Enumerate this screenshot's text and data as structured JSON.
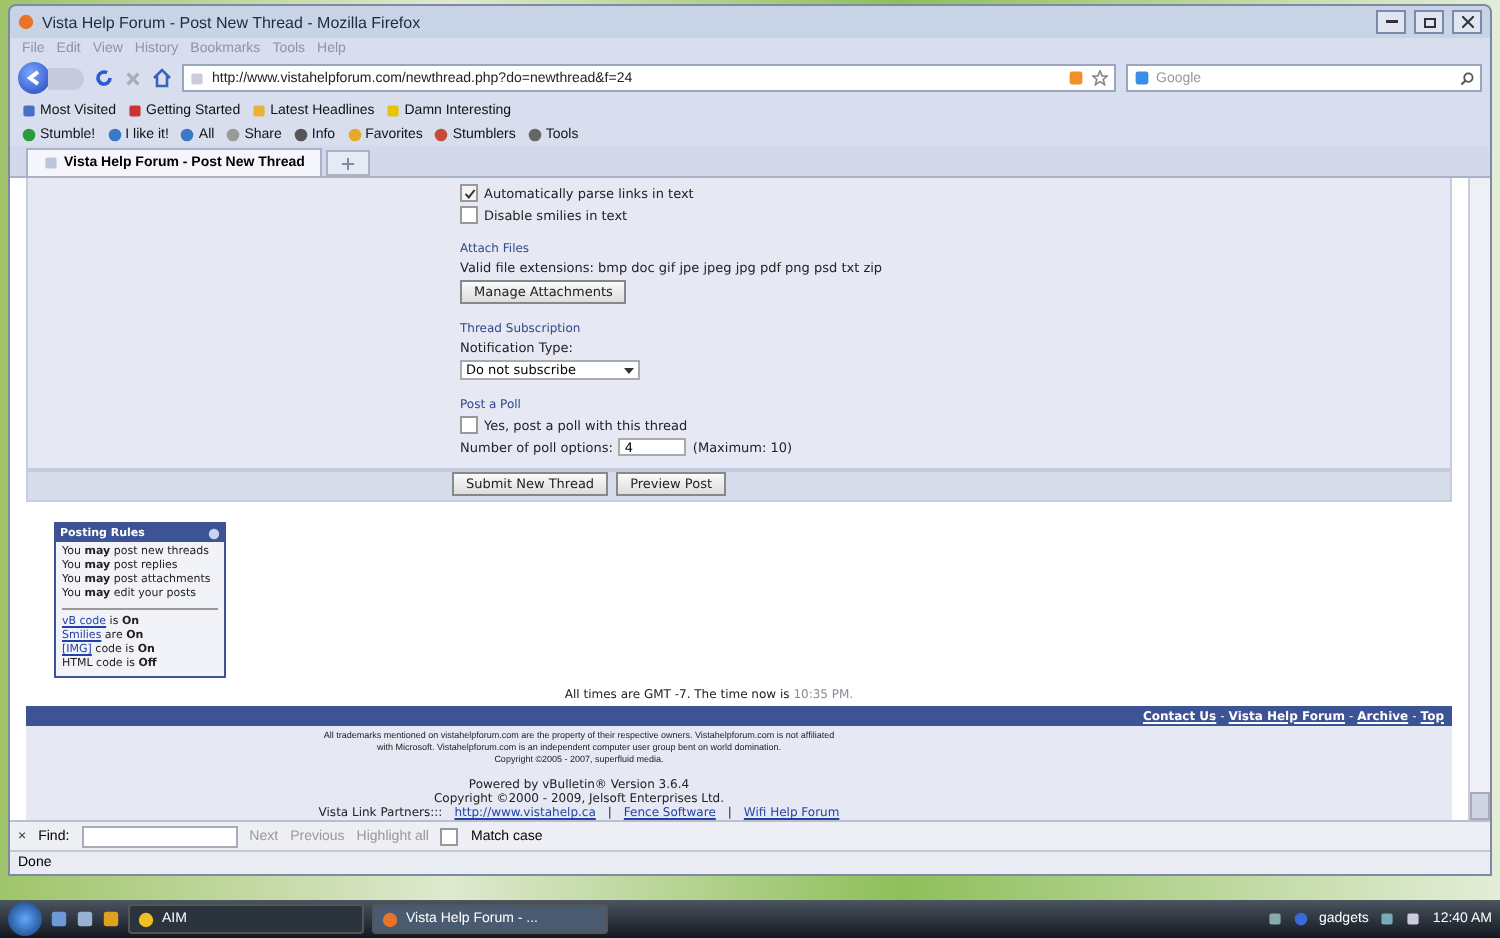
{
  "window": {
    "title": "Vista Help Forum - Post New Thread - Mozilla Firefox"
  },
  "menu": [
    "File",
    "Edit",
    "View",
    "History",
    "Bookmarks",
    "Tools",
    "Help"
  ],
  "address": {
    "url": "http://www.vistahelpforum.com/newthread.php?do=newthread&f=24"
  },
  "search": {
    "placeholder": "Google"
  },
  "bookmarks": [
    "Most Visited",
    "Getting Started",
    "Latest Headlines",
    "Damn Interesting"
  ],
  "stumble_toolbar": [
    "Stumble!",
    "I like it!",
    "All",
    "Share",
    "Info",
    "Favorites",
    "Stumblers",
    "Tools"
  ],
  "tabs": [
    {
      "label": "Vista Help Forum - Post New Thread",
      "selected": true
    }
  ],
  "options": [
    {
      "label": "Automatically parse links in text",
      "checked": true
    },
    {
      "label": "Disable smilies in text",
      "checked": false
    }
  ],
  "attach": {
    "heading": "Attach Files",
    "extensions": "Valid file extensions: bmp doc gif jpe jpeg jpg pdf png psd txt zip",
    "button": "Manage Attachments"
  },
  "subscription": {
    "heading": "Thread Subscription",
    "label": "Notification Type:",
    "value": "Do not subscribe"
  },
  "poll": {
    "heading": "Post a Poll",
    "checkbox": {
      "label": "Yes, post a poll with this thread",
      "checked": false
    },
    "options_label": "Number of poll options:",
    "options_value": "4",
    "max": "(Maximum: 10)"
  },
  "buttons": [
    "Submit New Thread",
    "Preview Post"
  ],
  "posting_rules": {
    "title": "Posting Rules",
    "permissions": [
      "You **may** post new threads",
      "You **may** post replies",
      "You **may** post attachments",
      "You **may** edit your posts"
    ],
    "codes": [
      {
        "link": "vB code",
        "text": " is **On**"
      },
      {
        "link": "Smilies",
        "text": " are **On**"
      },
      {
        "link": "[IMG]",
        "text": " code is **On**"
      },
      {
        "text": "HTML code is **Off**"
      }
    ]
  },
  "time_line": {
    "text": "All times are GMT -7. The time now is",
    "time": "10:35 PM."
  },
  "footer_links": [
    "Contact Us",
    "Vista Help Forum",
    "Archive",
    "Top"
  ],
  "footer_separator": "-",
  "disclaimer": [
    "All trademarks mentioned on vistahelpforum.com are the property of their respective owners. Vistahelpforum.com is not affiliated",
    "with Microsoft. Vistahelpforum.com is an independent computer user group bent on world domination.",
    "Copyright ©2005 - 2007, superfluid media."
  ],
  "powered": [
    "Powered by vBulletin® Version 3.6.4",
    "Copyright ©2000 - 2009, Jelsoft Enterprises Ltd."
  ],
  "partners": {
    "label": "Vista Link Partners:::",
    "links": [
      "http://www.vistahelp.ca",
      "Fence Software",
      "Wifi Help Forum"
    ],
    "separator": "|"
  },
  "find_bar": {
    "close": "×",
    "label": "Find:",
    "buttons": [
      "Next",
      "Previous",
      "Highlight all"
    ],
    "match_case": {
      "label": "Match case",
      "checked": false
    }
  },
  "status_bar": {
    "text": "Done"
  },
  "taskbar": {
    "items": [
      {
        "label": "AIM",
        "selected": false
      },
      {
        "label": "Vista Help Forum - ...",
        "selected": true
      }
    ],
    "gadgets": "gadgets",
    "clock": "12:40 AM"
  }
}
